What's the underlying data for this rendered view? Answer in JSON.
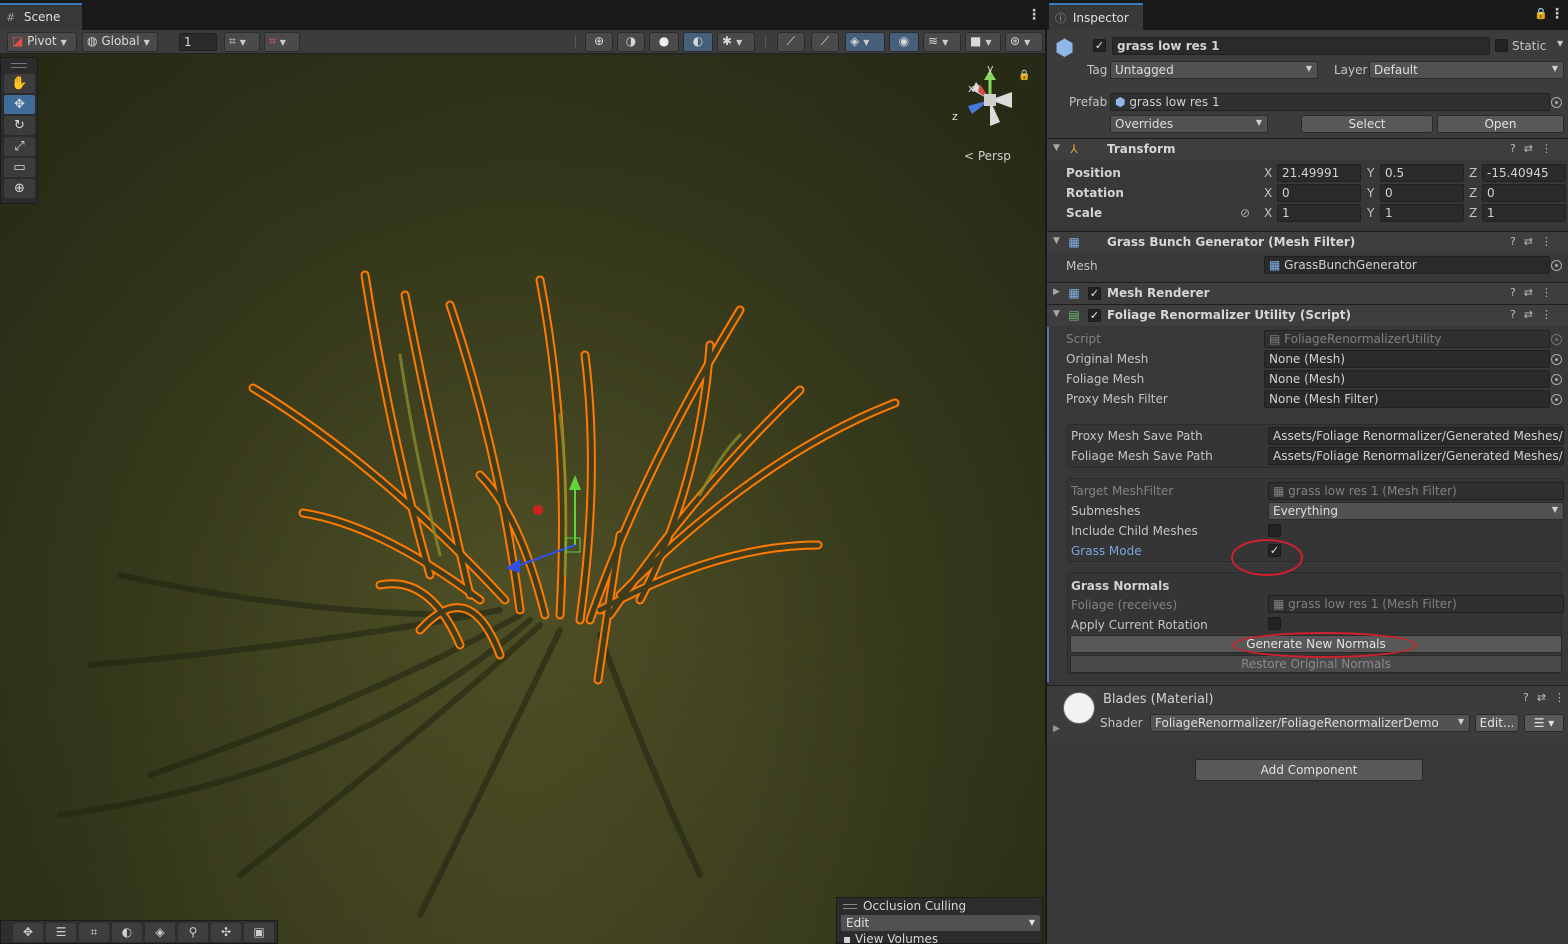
{
  "scene": {
    "tab_label": "Scene",
    "toolbar": {
      "pivot": "Pivot",
      "global": "Global",
      "grid_value": "1"
    },
    "persp_label": "< Persp",
    "gizmo_axes": {
      "y": "y",
      "x": "x",
      "z": "z"
    },
    "occlusion": {
      "title": "Occlusion Culling",
      "mode": "Edit",
      "view_volumes": "View Volumes"
    },
    "tools": [
      "hand-icon",
      "move-icon",
      "rotate-icon",
      "scale-icon",
      "rect-icon",
      "transform-icon"
    ],
    "selection_outline_color": "#ff7a00"
  },
  "inspector": {
    "tab_label": "Inspector",
    "object": {
      "name": "grass low res 1",
      "static_label": "Static",
      "tag_label": "Tag",
      "tag_value": "Untagged",
      "layer_label": "Layer",
      "layer_value": "Default"
    },
    "prefab": {
      "label": "Prefab",
      "value": "grass low res 1",
      "overrides": "Overrides",
      "select": "Select",
      "open": "Open"
    },
    "transform": {
      "title": "Transform",
      "position_label": "Position",
      "rotation_label": "Rotation",
      "scale_label": "Scale",
      "axes": {
        "x": "X",
        "y": "Y",
        "z": "Z"
      },
      "position": {
        "x": "21.49991",
        "y": "0.5",
        "z": "-15.40945"
      },
      "rotation": {
        "x": "0",
        "y": "0",
        "z": "0"
      },
      "scale": {
        "x": "1",
        "y": "1",
        "z": "1"
      }
    },
    "mesh_filter": {
      "title": "Grass Bunch Generator (Mesh Filter)",
      "mesh_label": "Mesh",
      "mesh_value": "GrassBunchGenerator"
    },
    "mesh_renderer": {
      "title": "Mesh Renderer"
    },
    "foliage": {
      "title": "Foliage Renormalizer Utility (Script)",
      "script_label": "Script",
      "script_value": "FoliageRenormalizerUtility",
      "original_mesh_label": "Original Mesh",
      "original_mesh_value": "None (Mesh)",
      "foliage_mesh_label": "Foliage Mesh",
      "foliage_mesh_value": "None (Mesh)",
      "proxy_filter_label": "Proxy Mesh Filter",
      "proxy_filter_value": "None (Mesh Filter)",
      "proxy_save_label": "Proxy Mesh Save Path",
      "proxy_save_value": "Assets/Foliage Renormalizer/Generated Meshes/Pr",
      "foliage_save_label": "Foliage Mesh Save Path",
      "foliage_save_value": "Assets/Foliage Renormalizer/Generated Meshes/Fo",
      "target_label": "Target MeshFilter",
      "target_value": "grass low res 1 (Mesh Filter)",
      "submeshes_label": "Submeshes",
      "submeshes_value": "Everything",
      "include_child_label": "Include Child Meshes",
      "grass_mode_label": "Grass Mode",
      "grass_normals_title": "Grass Normals",
      "foliage_receives_label": "Foliage (receives)",
      "foliage_receives_value": "grass low res 1 (Mesh Filter)",
      "apply_rotation_label": "Apply Current Rotation",
      "generate_button": "Generate New Normals",
      "restore_button": "Restore Original Normals",
      "include_child_checked": false,
      "grass_mode_checked": true,
      "apply_rotation_checked": false
    },
    "material": {
      "title": "Blades (Material)",
      "shader_label": "Shader",
      "shader_value": "FoliageRenormalizer/FoliageRenormalizerDemo",
      "edit_button": "Edit..."
    },
    "add_component": "Add Component",
    "annotation_color": "#d0202b"
  }
}
